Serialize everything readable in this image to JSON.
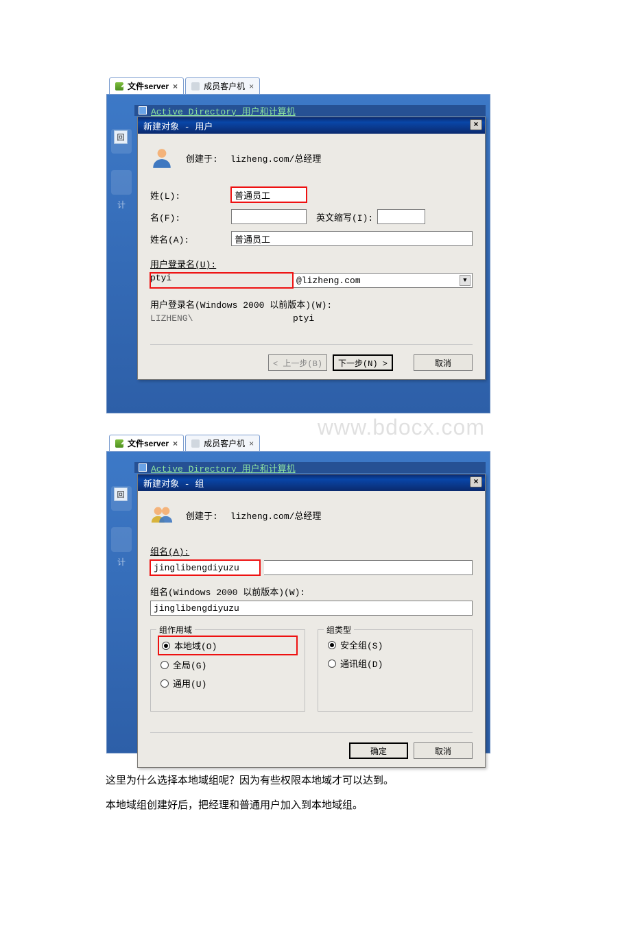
{
  "tabs": {
    "t1": "文件server",
    "t2": "成员客户机"
  },
  "ad_window_title": "Active Directory 用户和计算机",
  "desk_label_computer": "计",
  "dlg1": {
    "title": "新建对象 - 用户",
    "created_label": "创建于:",
    "created_path": "lizheng.com/总经理",
    "lbl_surname": "姓(L):",
    "val_surname": "普通员工",
    "lbl_given": "名(F):",
    "val_given": "",
    "lbl_initials": "英文缩写(I):",
    "val_initials": "",
    "lbl_fullname": "姓名(A):",
    "val_fullname": "普通员工",
    "lbl_logon": "用户登录名(U):",
    "val_logon": "ptyi",
    "domain_suffix": "@lizheng.com",
    "lbl_logon_pre": "用户登录名(Windows 2000 以前版本)(W):",
    "val_domain_prefix": "LIZHENG\\",
    "val_logon_pre": "ptyi",
    "btn_back": "< 上一步(B)",
    "btn_next": "下一步(N) >",
    "btn_cancel": "取消"
  },
  "watermark": "www.bdocx.com",
  "dlg2": {
    "title": "新建对象 - 组",
    "created_label": "创建于:",
    "created_path": "lizheng.com/总经理",
    "lbl_groupname": "组名(A):",
    "val_groupname": "jinglibengdiyuzu",
    "lbl_groupname_pre": "组名(Windows 2000 以前版本)(W):",
    "val_groupname_pre": "jinglibengdiyuzu",
    "legend_scope": "组作用域",
    "scope_local": "本地域(O)",
    "scope_global": "全局(G)",
    "scope_universal": "通用(U)",
    "legend_type": "组类型",
    "type_security": "安全组(S)",
    "type_dist": "通讯组(D)",
    "btn_ok": "确定",
    "btn_cancel": "取消"
  },
  "captions": {
    "p1": "这里为什么选择本地域组呢？因为有些权限本地域才可以达到。",
    "p2": "本地域组创建好后，把经理和普通用户加入到本地域组。"
  }
}
